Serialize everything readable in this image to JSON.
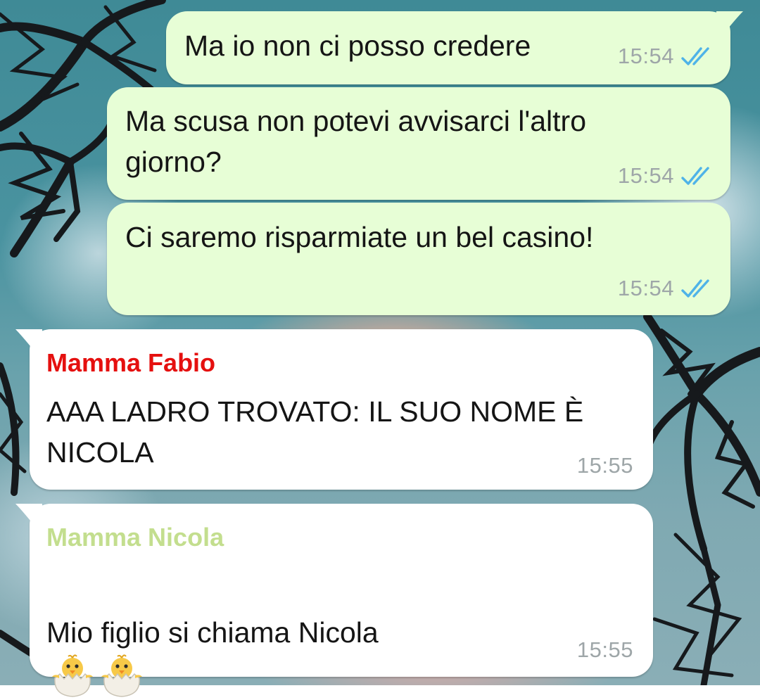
{
  "chat": {
    "messages": [
      {
        "direction": "outgoing",
        "text": "Ma io non ci posso credere",
        "time": "15:54",
        "status": "read"
      },
      {
        "direction": "outgoing",
        "text": "Ma scusa non potevi avvisarci l'altro\ngiorno?",
        "time": "15:54",
        "status": "read"
      },
      {
        "direction": "outgoing",
        "text": "Ci saremo risparmiate un bel casino!",
        "time": "15:54",
        "status": "read"
      },
      {
        "direction": "incoming",
        "sender": "Mamma Fabio",
        "sender_color": "#e5100f",
        "text": "AAA LADRO TROVATO: IL SUO NOME È\nNICOLA",
        "time": "15:55"
      },
      {
        "direction": "incoming",
        "sender": "Mamma Nicola",
        "sender_color": "#c3de8e",
        "text": "Mio figlio si chiama Nicola",
        "emojis": [
          "hatching-chick-icon",
          "hatching-chick-icon"
        ],
        "time": "15:55"
      }
    ]
  },
  "colors": {
    "outgoing_bubble": "#e7fed6",
    "incoming_bubble": "#ffffff",
    "read_ticks": "#4fb3e8",
    "time_text": "#9ea6a8",
    "message_text": "#151515"
  },
  "icons": {
    "read_receipt": "double-check-icon",
    "wallpaper": "palm-trees-sky-wallpaper"
  }
}
